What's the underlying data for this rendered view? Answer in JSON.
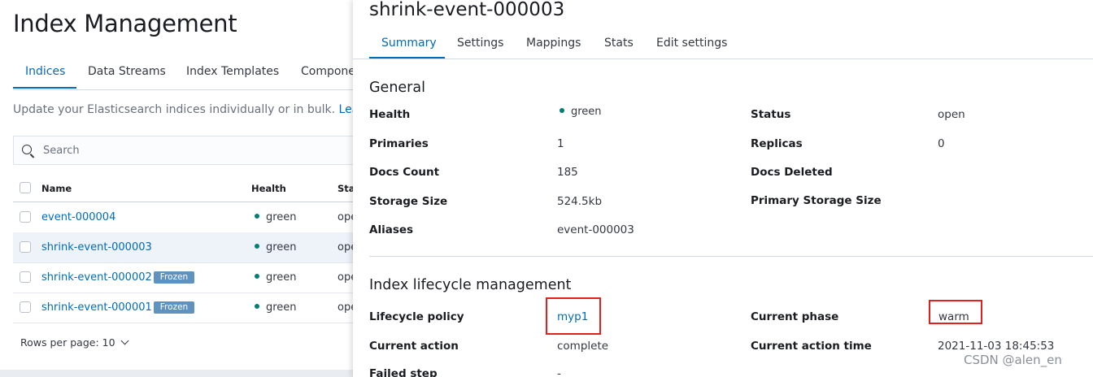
{
  "page": {
    "title": "Index Management",
    "tabs": [
      "Indices",
      "Data Streams",
      "Index Templates",
      "Compone"
    ],
    "description": "Update your Elasticsearch indices individually or in bulk.",
    "description_link": "Learn"
  },
  "search": {
    "placeholder": "Search"
  },
  "table": {
    "headers": [
      "Name",
      "Health",
      "Sta"
    ],
    "rows": [
      {
        "name": "event-000004",
        "badge": "",
        "health": "green",
        "status": "ope"
      },
      {
        "name": "shrink-event-000003",
        "badge": "",
        "health": "green",
        "status": "ope"
      },
      {
        "name": "shrink-event-000002",
        "badge": "Frozen",
        "health": "green",
        "status": "ope"
      },
      {
        "name": "shrink-event-000001",
        "badge": "Frozen",
        "health": "green",
        "status": "ope"
      }
    ],
    "rows_per_page": "Rows per page: 10"
  },
  "flyout": {
    "title": "shrink-event-000003",
    "tabs": [
      "Summary",
      "Settings",
      "Mappings",
      "Stats",
      "Edit settings"
    ],
    "general": {
      "title": "General",
      "health_label": "Health",
      "health_value": "green",
      "status_label": "Status",
      "status_value": "open",
      "primaries_label": "Primaries",
      "primaries_value": "1",
      "replicas_label": "Replicas",
      "replicas_value": "0",
      "docs_count_label": "Docs Count",
      "docs_count_value": "185",
      "docs_deleted_label": "Docs Deleted",
      "storage_size_label": "Storage Size",
      "storage_size_value": "524.5kb",
      "primary_storage_label": "Primary Storage Size",
      "aliases_label": "Aliases",
      "aliases_value": "event-000003"
    },
    "ilm": {
      "title": "Index lifecycle management",
      "policy_label": "Lifecycle policy",
      "policy_value": "myp1",
      "phase_label": "Current phase",
      "phase_value": "warm",
      "action_label": "Current action",
      "action_value": "complete",
      "action_time_label": "Current action time",
      "action_time_value": "2021-11-03 18:45:53",
      "failed_step_label": "Failed step",
      "failed_step_value": "-"
    }
  },
  "watermark": "CSDN @alen_en",
  "colors": {
    "accent": "#006bb8",
    "health_green": "#017d73",
    "frozen_badge": "#6092c0",
    "annotation_red": "#e32020"
  }
}
